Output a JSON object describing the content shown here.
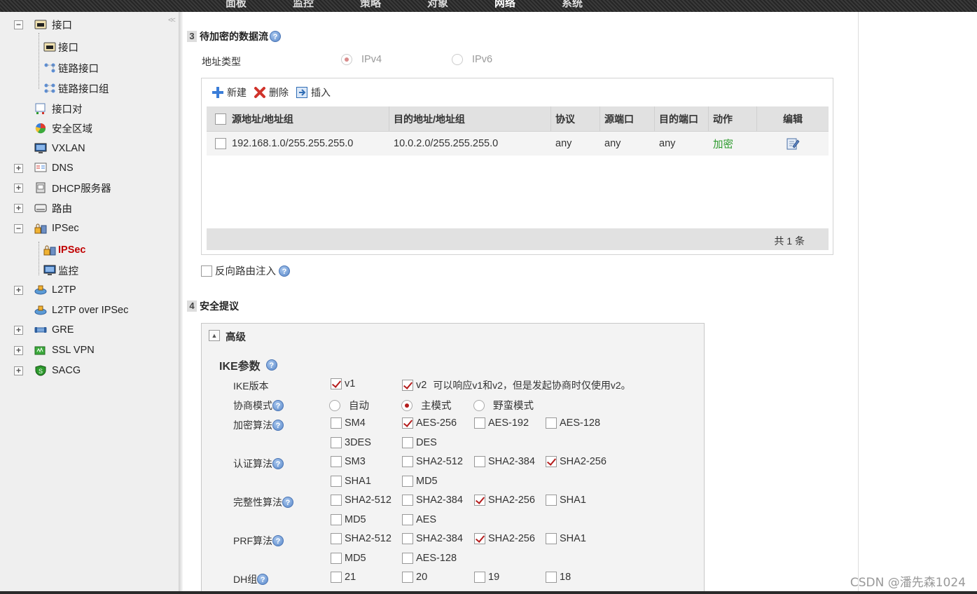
{
  "topnav": [
    "面板",
    "监控",
    "策略",
    "对象",
    "网络",
    "系统"
  ],
  "sidebar": {
    "collapse": "<<",
    "items": [
      {
        "label": "接口",
        "pm": "−",
        "icon": "interface-icon",
        "level": 0
      },
      {
        "label": "接口",
        "icon": "interface-icon",
        "level": 1
      },
      {
        "label": "链路接口",
        "icon": "link-icon",
        "level": 1
      },
      {
        "label": "链路接口组",
        "icon": "link-group-icon",
        "level": 1
      },
      {
        "label": "接口对",
        "icon": "interface-pair-icon",
        "level": 0
      },
      {
        "label": "安全区域",
        "icon": "zone-icon",
        "level": 0
      },
      {
        "label": "VXLAN",
        "icon": "monitor-icon",
        "level": 0
      },
      {
        "label": "DNS",
        "pm": "+",
        "icon": "dns-icon",
        "level": 0
      },
      {
        "label": "DHCP服务器",
        "pm": "+",
        "icon": "server-icon",
        "level": 0
      },
      {
        "label": "路由",
        "pm": "+",
        "icon": "router-icon",
        "level": 0
      },
      {
        "label": "IPSec",
        "pm": "−",
        "icon": "lock-icon",
        "level": 0
      },
      {
        "label": "IPSec",
        "icon": "lock-icon",
        "level": 1,
        "active": true
      },
      {
        "label": "监控",
        "icon": "monitor-icon",
        "level": 1
      },
      {
        "label": "L2TP",
        "pm": "+",
        "icon": "tunnel-icon",
        "level": 0
      },
      {
        "label": "L2TP over IPSec",
        "icon": "tunnel-icon",
        "level": 0
      },
      {
        "label": "GRE",
        "pm": "+",
        "icon": "pipe-icon",
        "level": 0
      },
      {
        "label": "SSL VPN",
        "pm": "+",
        "icon": "vpn-icon",
        "level": 0
      },
      {
        "label": "SACG",
        "pm": "+",
        "icon": "shield-icon",
        "level": 0
      }
    ]
  },
  "section3": {
    "num": "3",
    "title": "待加密的数据流",
    "addr_type_label": "地址类型",
    "ipv4": "IPv4",
    "ipv6": "IPv6",
    "toolbar": {
      "new": "新建",
      "delete": "删除",
      "insert": "插入"
    },
    "columns": [
      "源地址/地址组",
      "目的地址/地址组",
      "协议",
      "源端口",
      "目的端口",
      "动作",
      "编辑"
    ],
    "rows": [
      {
        "src": "192.168.1.0/255.255.255.0",
        "dst": "10.0.2.0/255.255.255.0",
        "proto": "any",
        "sport": "any",
        "dport": "any",
        "action": "加密"
      }
    ],
    "total": "共 1 条",
    "reverse_route": "反向路由注入"
  },
  "section4": {
    "num": "4",
    "title": "安全提议",
    "advanced": "高级",
    "ike_params": "IKE参数",
    "ike_version_label": "IKE版本",
    "v1": "v1",
    "v2": "v2",
    "v2_note": "可以响应v1和v2，但是发起协商时仅使用v2。",
    "mode_label": "协商模式",
    "mode_auto": "自动",
    "mode_main": "主模式",
    "mode_aggr": "野蛮模式",
    "enc_label": "加密算法",
    "enc": [
      [
        "SM4",
        false
      ],
      [
        "AES-256",
        true
      ],
      [
        "AES-192",
        false
      ],
      [
        "AES-128",
        false
      ],
      [
        "3DES",
        false
      ],
      [
        "DES",
        false
      ]
    ],
    "auth_label": "认证算法",
    "auth": [
      [
        "SM3",
        false
      ],
      [
        "SHA2-512",
        false
      ],
      [
        "SHA2-384",
        false
      ],
      [
        "SHA2-256",
        true
      ],
      [
        "SHA1",
        false
      ],
      [
        "MD5",
        false
      ]
    ],
    "integ_label": "完整性算法",
    "integ": [
      [
        "SHA2-512",
        false
      ],
      [
        "SHA2-384",
        false
      ],
      [
        "SHA2-256",
        true
      ],
      [
        "SHA1",
        false
      ],
      [
        "MD5",
        false
      ],
      [
        "AES",
        false
      ]
    ],
    "prf_label": "PRF算法",
    "prf": [
      [
        "SHA2-512",
        false
      ],
      [
        "SHA2-384",
        false
      ],
      [
        "SHA2-256",
        true
      ],
      [
        "SHA1",
        false
      ],
      [
        "MD5",
        false
      ],
      [
        "AES-128",
        false
      ]
    ],
    "dh_label": "DH组",
    "dh": [
      [
        "21",
        false
      ],
      [
        "20",
        false
      ],
      [
        "19",
        false
      ],
      [
        "18",
        false
      ]
    ]
  },
  "watermark": "CSDN @潘先森1024"
}
